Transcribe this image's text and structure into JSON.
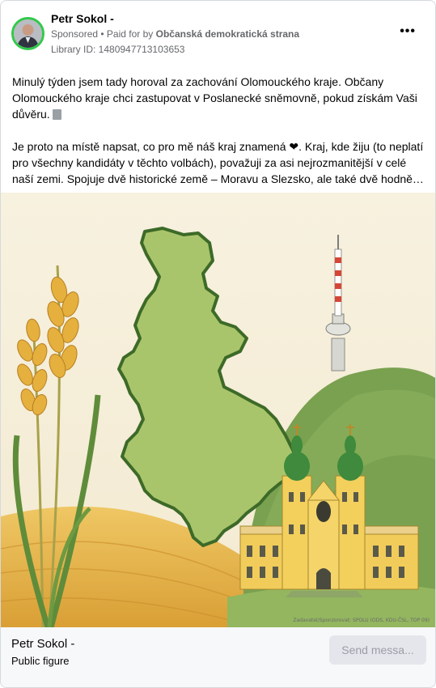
{
  "header": {
    "name": "Petr Sokol -",
    "sponsored": "Sponsored",
    "separator": " • ",
    "paid_prefix": "Paid for by ",
    "payer": "Občanská demokratická strana",
    "library_id": "Library ID: 1480947713103653",
    "more_label": "•••"
  },
  "post": {
    "paragraph1": "Minulý týden jsem tady horoval za zachování Olomouckého kraje. Občany Olomouckého kraje chci zastupovat v Poslanecké sněmovně, pokud získám Vaši důvěru.",
    "paragraph2": "Je proto na místě napsat, co pro mě náš kraj znamená ❤. Kraj, kde žiju (to neplatí pro všechny kandidáty v těchto volbách), považuji za asi nejrozmanitější v celé naší zemi. Spojuje dvě historické země – Moravu a Slezsko, ale také dvě hodně…"
  },
  "image": {
    "caption": "Zadavatel/Sponzorovat: SPOLU (ODS, KDU-ČSL, TOP 09)"
  },
  "footer": {
    "name": "Petr Sokol -",
    "subtitle": "Public figure",
    "send_button": "Send messa..."
  },
  "colors": {
    "avatar_ring": "#31c94a",
    "map_fill": "#a8c46a",
    "map_outline": "#3f6b2a",
    "sky": "#f6f0dc",
    "field": "#e7b94a",
    "hill": "#6e9a4a",
    "basilica": "#f1cc5a",
    "domes": "#3f8a3c"
  }
}
